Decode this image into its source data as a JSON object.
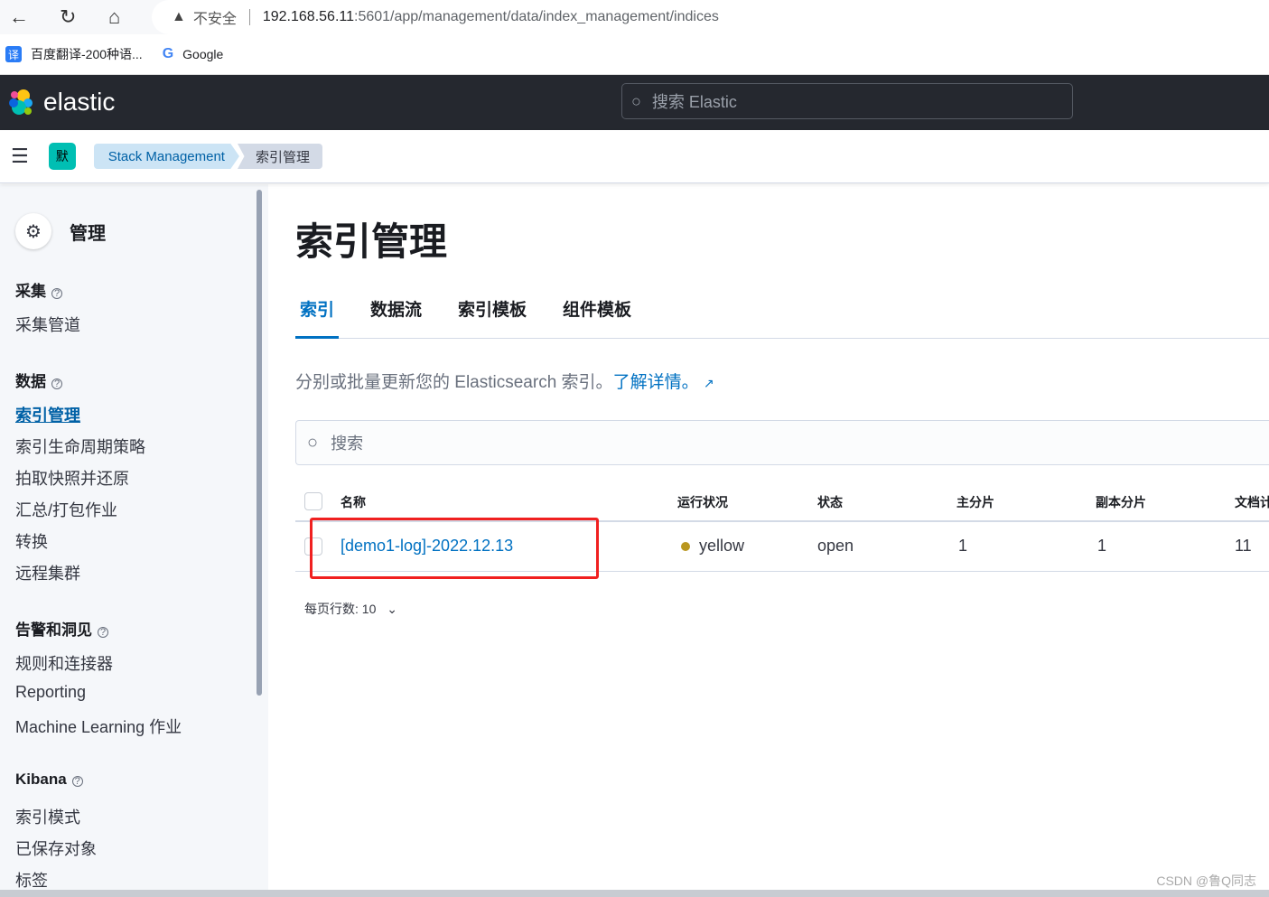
{
  "browser": {
    "security": "不安全",
    "url_host": "192.168.56.11",
    "url_path": ":5601/app/management/data/index_management/indices",
    "bookmarks": [
      {
        "label": "百度翻译-200种语...",
        "icon": "译"
      },
      {
        "label": "Google",
        "icon": "G"
      }
    ]
  },
  "header": {
    "brand": "elastic",
    "search_placeholder": "搜索 Elastic"
  },
  "breadcrumb": {
    "space": "默",
    "items": [
      "Stack Management",
      "索引管理"
    ]
  },
  "sidebar": {
    "title": "管理",
    "groups": [
      {
        "label": "采集",
        "items": [
          "采集管道"
        ]
      },
      {
        "label": "数据",
        "items": [
          "索引管理",
          "索引生命周期策略",
          "拍取快照并还原",
          "汇总/打包作业",
          "转换",
          "远程集群"
        ]
      },
      {
        "label": "告警和洞见",
        "items": [
          "规则和连接器",
          "Reporting",
          "Machine Learning 作业"
        ]
      },
      {
        "label": "Kibana",
        "items": [
          "索引模式",
          "已保存对象",
          "标签"
        ]
      }
    ],
    "active": "索引管理"
  },
  "main": {
    "title": "索引管理",
    "tabs": [
      "索引",
      "数据流",
      "索引模板",
      "组件模板"
    ],
    "active_tab": "索引",
    "description": "分别或批量更新您的 Elasticsearch 索引。",
    "learn_more": "了解详情。",
    "search_placeholder": "搜索",
    "columns": [
      "名称",
      "运行状况",
      "状态",
      "主分片",
      "副本分片",
      "文档计数"
    ],
    "rows": [
      {
        "name": "[demo1-log]-2022.12.13",
        "health": "yellow",
        "status": "open",
        "primary": "1",
        "replica": "1",
        "docs": "11"
      }
    ],
    "rows_per_page": "每页行数: 10"
  },
  "colors": {
    "accent": "#0071c2",
    "health_yellow": "#b9961f",
    "highlight": "#f02020"
  },
  "watermark": "CSDN @鲁Q同志"
}
